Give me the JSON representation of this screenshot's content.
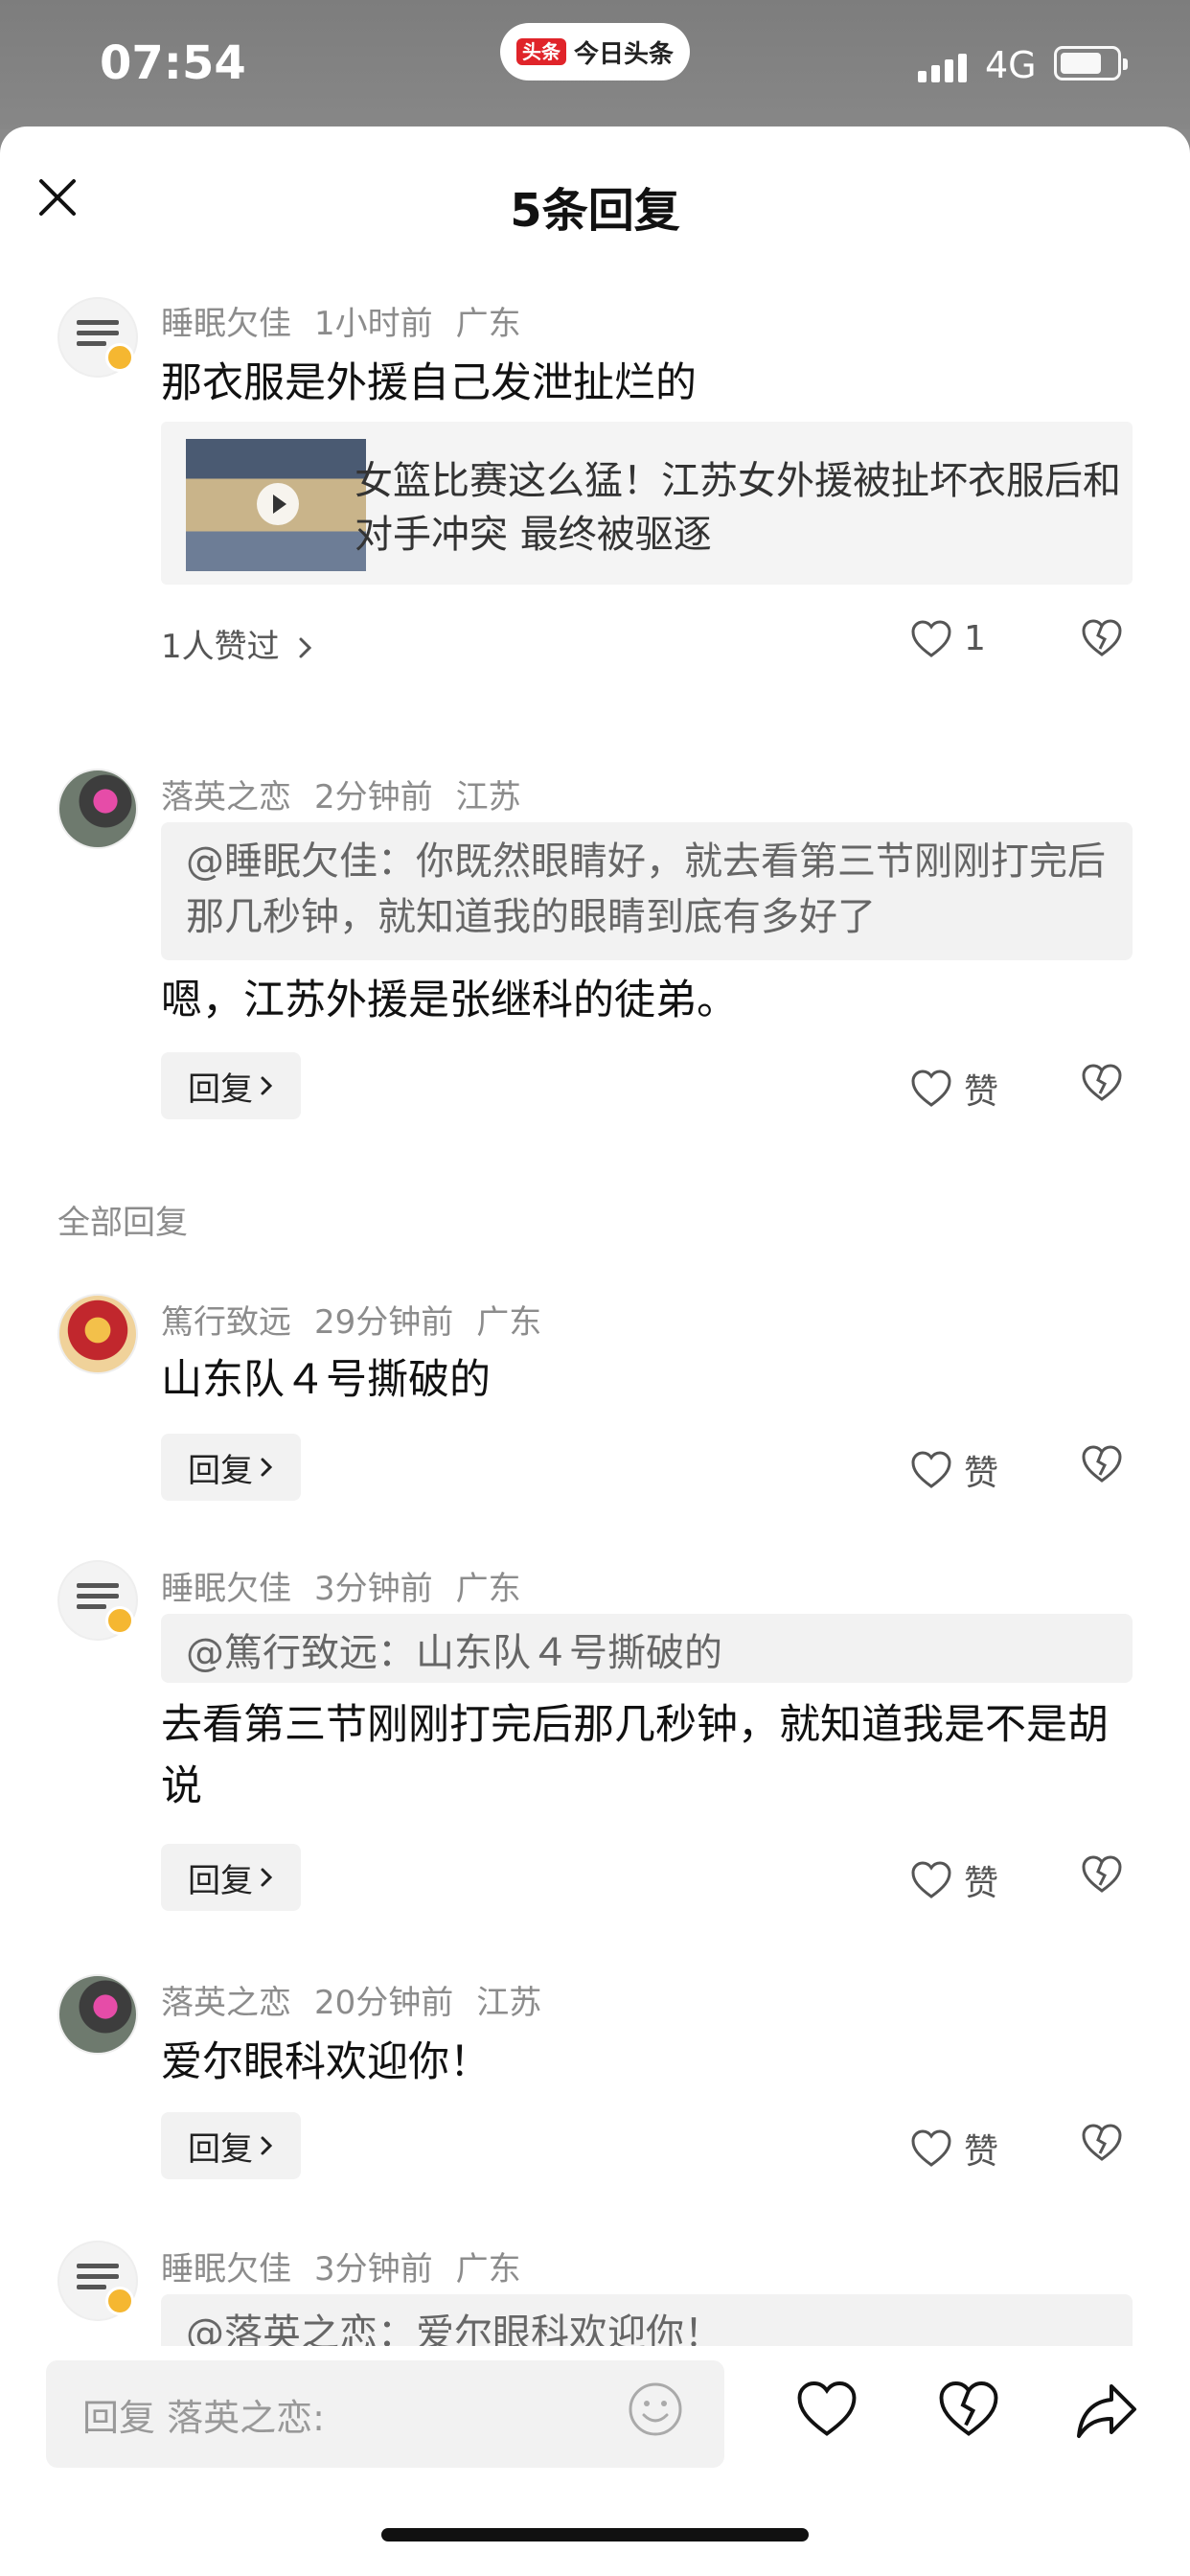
{
  "status_bar": {
    "time": "07:54",
    "app_badge": "头条",
    "app_name": "今日头条",
    "network": "4G"
  },
  "sheet": {
    "title": "5条回复"
  },
  "top_comment": {
    "user": "睡眠欠佳",
    "time": "1小时前",
    "location": "广东",
    "text": "那衣服是外援自己发泄扯烂的",
    "article_title": "女篮比赛这么猛！江苏女外援被扯坏衣服后和对手冲突 最终被驱逐",
    "likers": "1人赞过",
    "like_count": "1"
  },
  "pinned_reply": {
    "user": "落英之恋",
    "time": "2分钟前",
    "location": "江苏",
    "quote": "@睡眠欠佳：你既然眼睛好，就去看第三节刚刚打完后那几秒钟，就知道我的眼睛到底有多好了",
    "text": "嗯，江苏外援是张继科的徒弟。",
    "reply_label": "回复",
    "like_label": "赞"
  },
  "section_label": "全部回复",
  "replies": [
    {
      "user": "篤行致远",
      "time": "29分钟前",
      "location": "广东",
      "quote": "",
      "text": "山东队４号撕破的",
      "reply_label": "回复",
      "like_label": "赞"
    },
    {
      "user": "睡眠欠佳",
      "time": "3分钟前",
      "location": "广东",
      "quote": "@篤行致远：山东队４号撕破的",
      "text": "去看第三节刚刚打完后那几秒钟，就知道我是不是胡说",
      "reply_label": "回复",
      "like_label": "赞"
    },
    {
      "user": "落英之恋",
      "time": "20分钟前",
      "location": "江苏",
      "quote": "",
      "text": "爱尔眼科欢迎你！",
      "reply_label": "回复",
      "like_label": "赞"
    },
    {
      "user": "睡眠欠佳",
      "time": "3分钟前",
      "location": "广东",
      "quote": "@落英之恋：爱尔眼科欢迎你！",
      "text": "",
      "reply_label": "",
      "like_label": ""
    }
  ],
  "bottom_bar": {
    "input_placeholder": "回复 落英之恋:"
  },
  "colors": {
    "badge_red": "#e0242a",
    "meta_gray": "#8c8c8c",
    "chip_bg": "#f2f2f2"
  }
}
